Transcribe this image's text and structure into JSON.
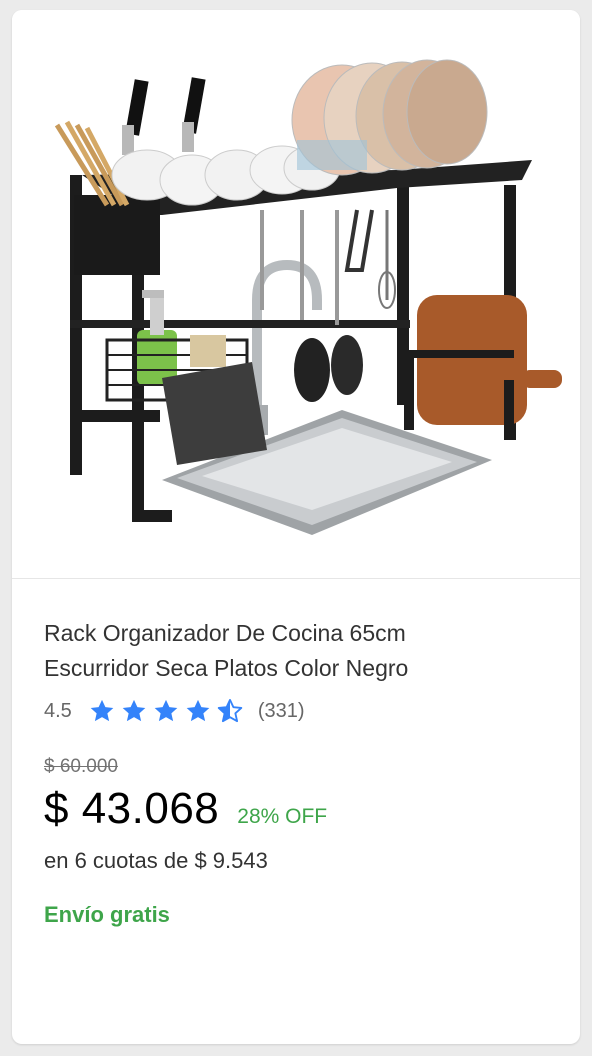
{
  "product": {
    "title_line1": "Rack Organizador De Cocina 65cm",
    "title_line2": "Escurridor Seca Platos Color Negro",
    "rating": "4.5",
    "rating_stars": 4.5,
    "review_count": "(331)",
    "original_price": "$ 60.000",
    "current_price": "$ 43.068",
    "discount": "28% OFF",
    "installments": "en 6 cuotas de $ 9.543",
    "shipping": "Envío gratis"
  },
  "colors": {
    "star": "#3483fa",
    "green": "#3ea54a"
  },
  "icons": {
    "star_full": "star-icon",
    "star_half": "star-half-icon"
  }
}
